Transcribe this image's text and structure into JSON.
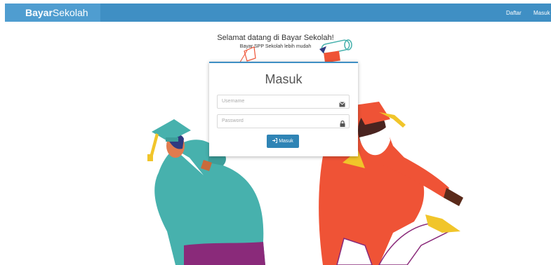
{
  "navbar": {
    "brand_bold": "Bayar",
    "brand_rest": "Sekolah",
    "links": [
      "Daftar",
      "Masuk"
    ]
  },
  "hero": {
    "welcome": "Selamat datang di Bayar Sekolah!",
    "tagline": "Bayar SPP Sekolah lebih mudah"
  },
  "login": {
    "title": "Masuk",
    "username_placeholder": "Username",
    "password_placeholder": "Password",
    "submit_label": "Masuk",
    "icons": [
      "envelope-icon",
      "lock-icon",
      "sign-in-icon"
    ]
  },
  "colors": {
    "navbar": "#3f8fc4",
    "brand_box": "#4f9dd0",
    "button": "#2f84b5",
    "gown_teal": "#47b1ad",
    "gown_red": "#ef5336",
    "accent_yellow": "#f1c52a"
  }
}
